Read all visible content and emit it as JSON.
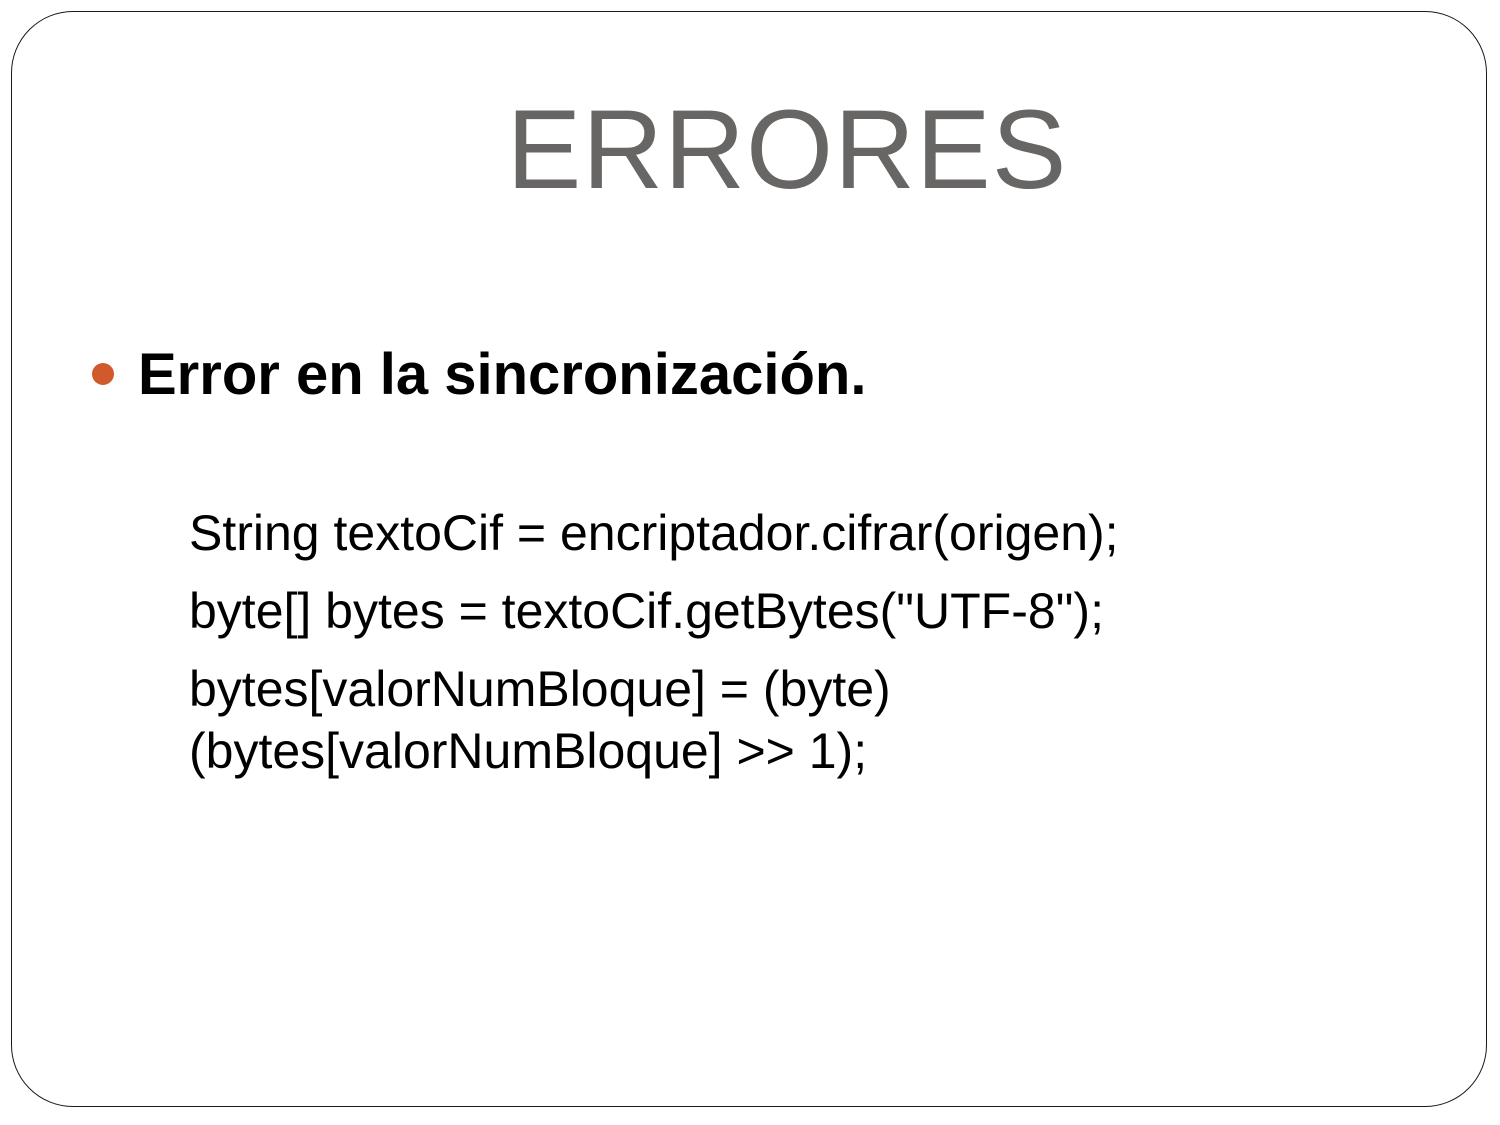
{
  "slide": {
    "title": "ERRORES",
    "bullet": {
      "text": "Error en la sincronización.",
      "color": "#d15a2c"
    },
    "code_lines": [
      "String textoCif = encriptador.cifrar(origen);",
      "byte[] bytes = textoCif.getBytes(\"UTF-8\");",
      "bytes[valorNumBloque] = (byte)",
      "(bytes[valorNumBloque] >> 1);"
    ]
  }
}
